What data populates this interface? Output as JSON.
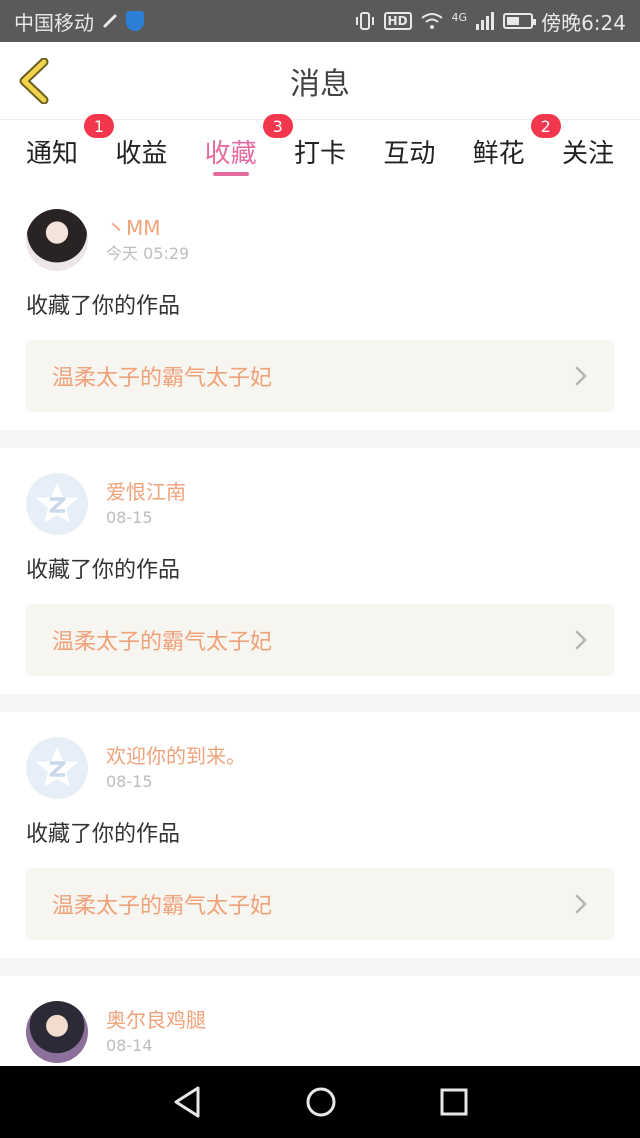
{
  "status_bar": {
    "carrier": "中国移动",
    "time": "傍晚6:24",
    "network": "4G",
    "hd": "HD",
    "battery_level": 0.55
  },
  "nav": {
    "title": "消息"
  },
  "tabs": [
    {
      "label": "通知",
      "badge": "1"
    },
    {
      "label": "收益",
      "badge": ""
    },
    {
      "label": "收藏",
      "badge": "3",
      "active": true
    },
    {
      "label": "打卡",
      "badge": ""
    },
    {
      "label": "互动",
      "badge": ""
    },
    {
      "label": "鲜花",
      "badge": "2"
    },
    {
      "label": "关注",
      "badge": ""
    }
  ],
  "items": [
    {
      "user": "丶MM",
      "time": "今天 05:29",
      "action": "收藏了你的作品",
      "work": "温柔太子的霸气太子妃",
      "avatar": "photo1"
    },
    {
      "user": "爱恨江南",
      "time": "08-15",
      "action": "收藏了你的作品",
      "work": "温柔太子的霸气太子妃",
      "avatar": "default"
    },
    {
      "user": "欢迎你的到来。",
      "time": "08-15",
      "action": "收藏了你的作品",
      "work": "温柔太子的霸气太子妃",
      "avatar": "default"
    },
    {
      "user": "奥尔良鸡腿",
      "time": "08-14",
      "avatar": "photo2"
    }
  ],
  "icons": {
    "back": "chevron-left-icon",
    "chevron": "chevron-right-icon",
    "default_avatar": "qq-default-avatar-icon"
  },
  "colors": {
    "accent": "#e66ba0",
    "name": "#f0a27a",
    "badge": "#f2374c"
  }
}
